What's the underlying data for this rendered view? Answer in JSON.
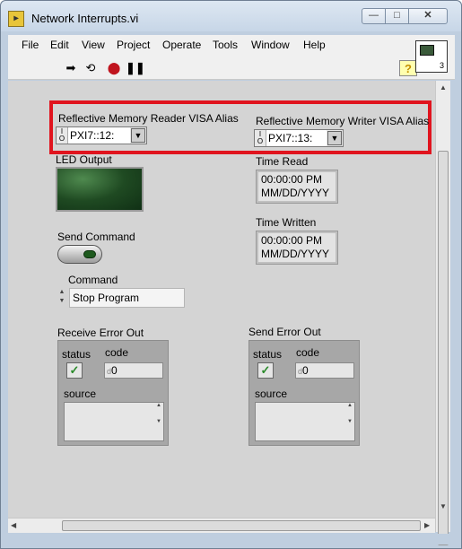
{
  "window": {
    "title": "Network Interrupts.vi",
    "app_icon": "labview-vi-icon"
  },
  "menu": {
    "items": [
      "File",
      "Edit",
      "View",
      "Project",
      "Operate",
      "Tools",
      "Window",
      "Help"
    ]
  },
  "toolbar": {
    "run": "run-arrow-icon",
    "run_continuous": "run-continuously-icon",
    "abort": "abort-icon",
    "pause": "pause-icon",
    "help": "?",
    "vi_icon_number": "3"
  },
  "panel": {
    "reader_label": "Reflective Memory Reader VISA Alias",
    "reader_value": "PXI7::12:",
    "writer_label": "Reflective Memory Writer VISA Alias",
    "writer_value": "PXI7::13:",
    "led_label": "LED Output",
    "time_read_label": "Time Read",
    "time_read_value": "00:00:00 PM\nMM/DD/YYYY",
    "time_written_label": "Time Written",
    "time_written_value": "00:00:00 PM\nMM/DD/YYYY",
    "send_command_label": "Send Command",
    "command_label": "Command",
    "command_value": "Stop Program",
    "receive_error": {
      "title": "Receive Error Out",
      "status_label": "status",
      "code_label": "code",
      "code_value": "0",
      "source_label": "source",
      "status_checked": true
    },
    "send_error": {
      "title": "Send Error Out",
      "status_label": "status",
      "code_label": "code",
      "code_value": "0",
      "source_label": "source",
      "status_checked": true
    }
  },
  "colors": {
    "highlight": "#e0141e",
    "panel": "#d4d4d4",
    "led_off": "#1f4a22"
  }
}
